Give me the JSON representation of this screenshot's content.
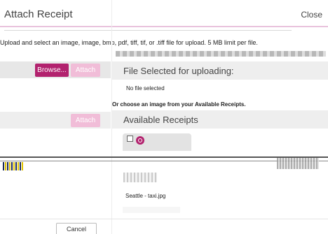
{
  "dialog": {
    "title": "Attach Receipt",
    "close_label": "Close",
    "instructions": "Upload and select an image, image, bmp, pdf, tiff, tif, or .tiff file for upload. 5 MB limit per file.",
    "cancel_label": "Cancel"
  },
  "upload": {
    "browse_label": "Browse...",
    "attach_label": "Attach",
    "section_title": "File Selected for uploading:",
    "no_file_text": "No file selected",
    "or_choose_text": "Or choose an image from your Available Receipts."
  },
  "receipts": {
    "attach_label": "Attach",
    "section_title": "Available Receipts",
    "items": [
      {
        "name": "Seattle - taxi.jpg",
        "checked": false
      }
    ]
  },
  "colors": {
    "accent": "#b2226e",
    "accent_disabled": "#f1bdd8",
    "panel_bg": "#eeeeee"
  },
  "icons": {
    "zoom": "magnifier-icon",
    "checkbox": "checkbox-icon"
  }
}
